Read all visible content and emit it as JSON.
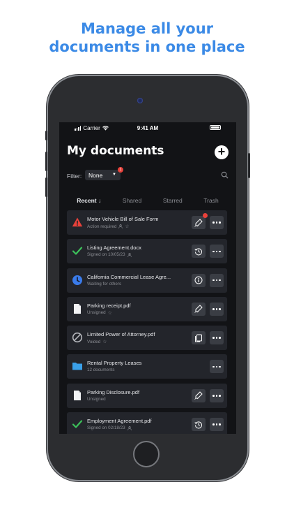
{
  "headline": {
    "line1": "Manage all your",
    "line2": "documents in one place"
  },
  "status_bar": {
    "carrier": "Carrier",
    "time": "9:41 AM"
  },
  "page": {
    "title": "My documents"
  },
  "filter": {
    "label": "Filter:",
    "value": "None",
    "badge": "1"
  },
  "tabs": [
    {
      "label": "Recent ↓",
      "active": true
    },
    {
      "label": "Shared",
      "active": false
    },
    {
      "label": "Starred",
      "active": false
    },
    {
      "label": "Trash",
      "active": false
    }
  ],
  "documents": [
    {
      "name": "Motor Vehicle Bill of Sale Form",
      "subtitle": "Action required",
      "icon": "warning-icon",
      "action": "sign-icon",
      "action_badge": "1"
    },
    {
      "name": "Listing Agreement.docx",
      "subtitle": "Signed on 10/05/23",
      "icon": "check-icon",
      "action": "history-icon"
    },
    {
      "name": "California Commercial Lease Agre...",
      "subtitle": "Waiting for others",
      "icon": "clock-icon",
      "action": "info-icon"
    },
    {
      "name": "Parking receipt.pdf",
      "subtitle": "Unsigned",
      "icon": "file-icon",
      "action": "sign-icon"
    },
    {
      "name": "Limited Power of Attorney.pdf",
      "subtitle": "Voided",
      "icon": "void-icon",
      "action": "copy-icon"
    },
    {
      "name": "Rental Property Leases",
      "subtitle": "12 documents",
      "icon": "folder-icon",
      "action": null
    },
    {
      "name": "Parking Disclosure.pdf",
      "subtitle": "Unsigned",
      "icon": "file-icon",
      "action": "sign-icon"
    },
    {
      "name": "Employment Agreement.pdf",
      "subtitle": "Signed on 02/18/23",
      "icon": "check-icon",
      "action": "history-icon"
    }
  ],
  "colors": {
    "accent": "#3b8ae6",
    "warning": "#e8413a",
    "success": "#3cc15a",
    "pending": "#3a7bea",
    "folder": "#3aa0e8"
  }
}
